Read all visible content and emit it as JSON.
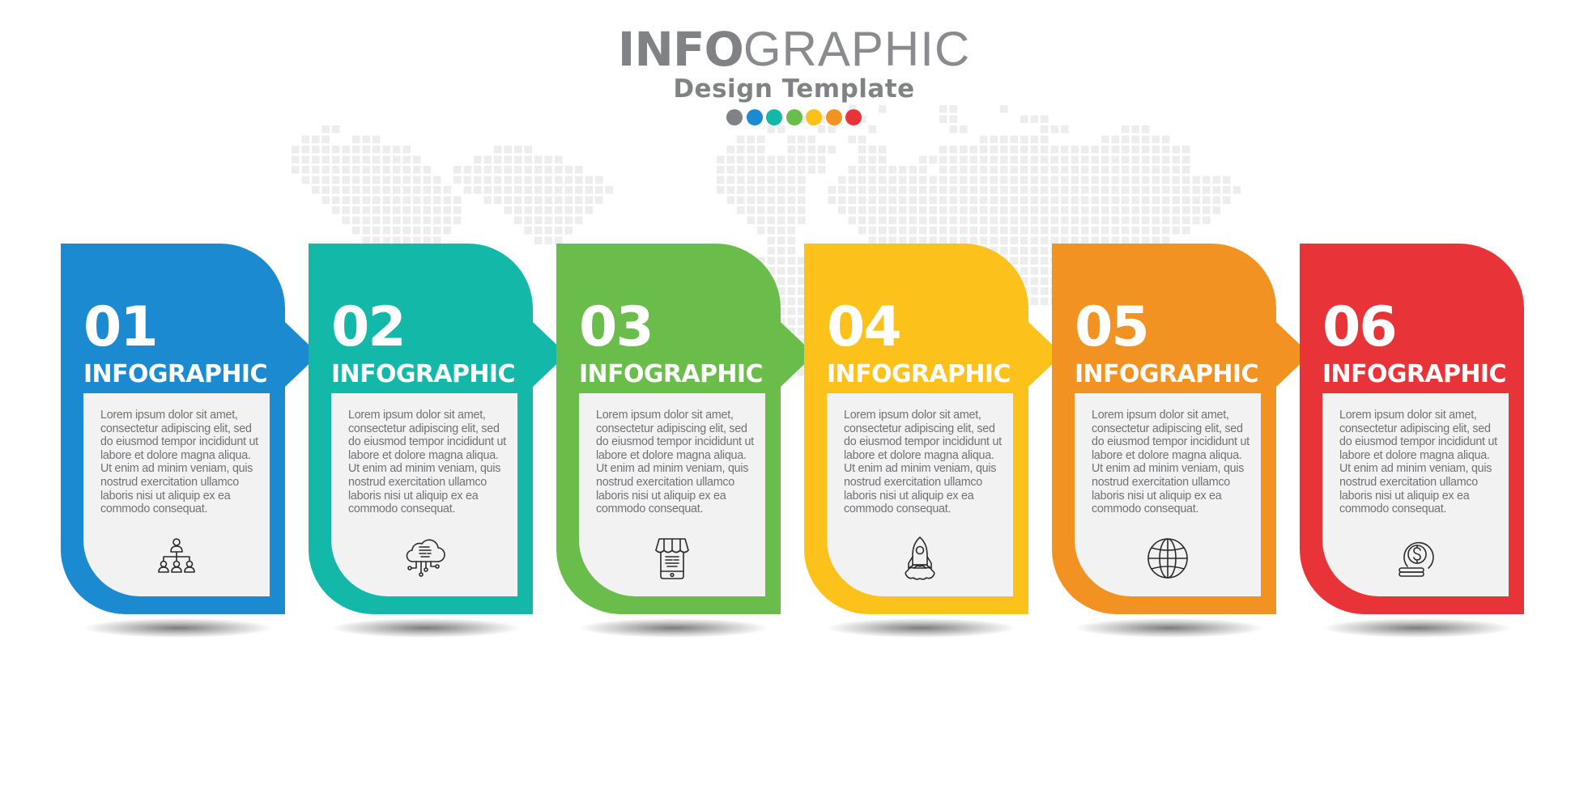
{
  "header": {
    "title_bold": "INFO",
    "title_light": "GRAPHIC",
    "subtitle": "Design Template",
    "palette": [
      {
        "name": "gray",
        "color": "#808285"
      },
      {
        "name": "blue",
        "color": "#1b8ad1"
      },
      {
        "name": "teal",
        "color": "#13b8a9"
      },
      {
        "name": "green",
        "color": "#6abd4b"
      },
      {
        "name": "yellow",
        "color": "#fcc11b"
      },
      {
        "name": "orange",
        "color": "#f29222"
      },
      {
        "name": "red",
        "color": "#e83438"
      }
    ]
  },
  "background": {
    "type": "pixelated-world-map",
    "color": "#ededee"
  },
  "steps": [
    {
      "number": "01",
      "heading": "INFOGRAPHIC",
      "color": "#1b8ad1",
      "icon": "org-chart-icon",
      "body": "Lorem ipsum dolor sit amet, consectetur adipiscing elit, sed do eiusmod tempor incididunt ut labore et dolore magna aliqua. Ut enim ad minim veniam, quis nostrud exercitation ullamco laboris nisi ut aliquip ex ea commodo consequat."
    },
    {
      "number": "02",
      "heading": "INFOGRAPHIC",
      "color": "#13b8a9",
      "icon": "cloud-network-icon",
      "body": "Lorem ipsum dolor sit amet, consectetur adipiscing elit, sed do eiusmod tempor incididunt ut labore et dolore magna aliqua. Ut enim ad minim veniam, quis nostrud exercitation ullamco laboris nisi ut aliquip ex ea commodo consequat."
    },
    {
      "number": "03",
      "heading": "INFOGRAPHIC",
      "color": "#6abd4b",
      "icon": "mobile-shop-icon",
      "body": "Lorem ipsum dolor sit amet, consectetur adipiscing elit, sed do eiusmod tempor incididunt ut labore et dolore magna aliqua. Ut enim ad minim veniam, quis nostrud exercitation ullamco laboris nisi ut aliquip ex ea commodo consequat."
    },
    {
      "number": "04",
      "heading": "INFOGRAPHIC",
      "color": "#fcc11b",
      "icon": "rocket-icon",
      "body": "Lorem ipsum dolor sit amet, consectetur adipiscing elit, sed do eiusmod tempor incididunt ut labore et dolore magna aliqua. Ut enim ad minim veniam, quis nostrud exercitation ullamco laboris nisi ut aliquip ex ea commodo consequat."
    },
    {
      "number": "05",
      "heading": "INFOGRAPHIC",
      "color": "#f29222",
      "icon": "globe-icon",
      "body": "Lorem ipsum dolor sit amet, consectetur adipiscing elit, sed do eiusmod tempor incididunt ut labore et dolore magna aliqua. Ut enim ad minim veniam, quis nostrud exercitation ullamco laboris nisi ut aliquip ex ea commodo consequat."
    },
    {
      "number": "06",
      "heading": "INFOGRAPHIC",
      "color": "#e83438",
      "icon": "dollar-coins-icon",
      "body": "Lorem ipsum dolor sit amet, consectetur adipiscing elit, sed do eiusmod tempor incididunt ut labore et dolore magna aliqua. Ut enim ad minim veniam, quis nostrud exercitation ullamco laboris nisi ut aliquip ex ea commodo consequat."
    }
  ]
}
